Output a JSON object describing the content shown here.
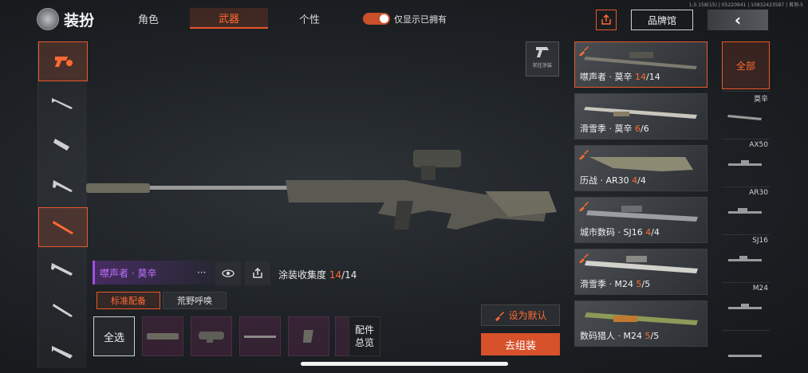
{
  "version": "1.0.158(15) | 05220941 | 10832423587 | 首测-5",
  "header": {
    "title": "装扮",
    "tabs": [
      {
        "label": "角色",
        "active": false
      },
      {
        "label": "武器",
        "active": true
      },
      {
        "label": "个性",
        "active": false
      }
    ],
    "toggle_label": "仅显示已拥有",
    "toggle_on": true,
    "brand_label": "品牌馆",
    "back_icon": "‹"
  },
  "rail": {
    "items": [
      {
        "icon": "pistol-logo-icon",
        "active": true
      },
      {
        "icon": "assault-rifle-icon",
        "active": false
      },
      {
        "icon": "smg-icon",
        "active": false
      },
      {
        "icon": "shotgun-icon",
        "active": false
      },
      {
        "icon": "sniper-rifle-icon",
        "active": true
      },
      {
        "icon": "rifle-icon",
        "active": false
      },
      {
        "icon": "marksman-rifle-icon",
        "active": false
      },
      {
        "icon": "lmg-icon",
        "active": false
      }
    ]
  },
  "goto_paint_label": "前往涂装",
  "skin_info": {
    "name": "噤声者 · 莫辛",
    "more": "···",
    "collect_label": "涂装收集度",
    "collect_have": "14",
    "collect_total": "/14"
  },
  "sub_tabs": [
    {
      "label": "标准配备",
      "active": true
    },
    {
      "label": "荒野呼唤",
      "active": false
    }
  ],
  "parts": {
    "select_all": "全选",
    "overview": "配件总览"
  },
  "actions": {
    "set_default": "设为默认",
    "equip": "去组装"
  },
  "cards": [
    {
      "prefix": "噤声者 · 莫辛 ",
      "have": "14",
      "total": "/14",
      "active": true,
      "brush": true
    },
    {
      "prefix": "滑雪季 · 莫辛 ",
      "have": "6",
      "total": "/6",
      "active": false,
      "brush": false
    },
    {
      "prefix": "历战 · AR30 ",
      "have": "4",
      "total": "/4",
      "active": false,
      "brush": true
    },
    {
      "prefix": "城市数码 · SJ16 ",
      "have": "4",
      "total": "/4",
      "active": false,
      "brush": true
    },
    {
      "prefix": "滑雪季 · M24 ",
      "have": "5",
      "total": "/5",
      "active": false,
      "brush": true
    },
    {
      "prefix": "数码猎人 · M24 ",
      "have": "5",
      "total": "/5",
      "active": false,
      "brush": false
    }
  ],
  "models": {
    "all_label": "全部",
    "items": [
      "莫辛",
      "AX50",
      "AR30",
      "SJ16",
      "M24",
      ""
    ]
  },
  "colors": {
    "accent": "#e8582a",
    "purple": "#c070ff"
  }
}
